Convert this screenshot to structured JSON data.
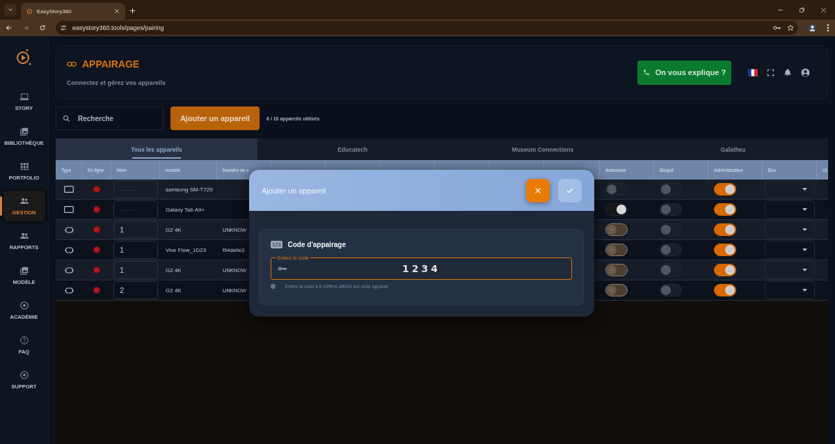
{
  "browser": {
    "tab_title": "EasyStory360",
    "url": "easystory360.tools/pages/pairing"
  },
  "sidebar": {
    "items": [
      {
        "label": "STORY",
        "selected": false
      },
      {
        "label": "BIBLIOTHÈQUE",
        "selected": false
      },
      {
        "label": "PORTFOLIO",
        "selected": false
      },
      {
        "label": "GESTION",
        "selected": true
      },
      {
        "label": "RAPPORTS",
        "selected": false
      },
      {
        "label": "MODÈLE",
        "selected": false
      },
      {
        "label": "ACADÉMIE",
        "selected": false
      },
      {
        "label": "FAQ",
        "selected": false
      },
      {
        "label": "SUPPORT",
        "selected": false
      }
    ]
  },
  "header": {
    "title": "APPAIRAGE",
    "subtitle": "Connectez et gérez vos appareils",
    "help_button": "On vous explique ?"
  },
  "toolbar": {
    "search_placeholder": "Recherche",
    "add_button": "Ajouter un appareil",
    "usage": "6 / 10 appareils utilisés"
  },
  "tabs": [
    {
      "label": "Tous les appareils",
      "selected": true
    },
    {
      "label": "Educatech",
      "selected": false
    },
    {
      "label": "Museum Connections",
      "selected": false
    },
    {
      "label": "Galathea",
      "selected": false
    }
  ],
  "table": {
    "columns": [
      "Type",
      "En ligne",
      "Nom",
      "modèle",
      "Numéro de s",
      "Autonome",
      "Bloqué",
      "Administrateur",
      "Box",
      "Ut"
    ],
    "rows": [
      {
        "kind": "tablet",
        "online": false,
        "name": "------",
        "model": "samsung SM-T720",
        "autonome": false,
        "autonome_disabled": false,
        "blocked": false,
        "admin": true
      },
      {
        "kind": "tablet",
        "online": false,
        "name": "------",
        "model": "Galaxy Tab A9+",
        "autonome": true,
        "autonome_disabled": false,
        "blocked": false,
        "admin": true
      },
      {
        "kind": "headset",
        "online": false,
        "name": "1",
        "model": "G2 4K",
        "serial": "UNKNOW",
        "autonome": false,
        "autonome_disabled": true,
        "blocked": false,
        "admin": true
      },
      {
        "kind": "headset",
        "online": false,
        "name": "1",
        "model": "Vive Flow_1D23",
        "serial": "f94da9e3",
        "autonome": false,
        "autonome_disabled": true,
        "blocked": false,
        "admin": true
      },
      {
        "kind": "headset",
        "online": false,
        "name": "1",
        "model": "G2 4K",
        "serial": "UNKNOW",
        "autonome": false,
        "autonome_disabled": true,
        "blocked": false,
        "admin": true
      },
      {
        "kind": "headset",
        "online": false,
        "name": "2",
        "model": "G2 4K",
        "serial": "UNKNOW",
        "autonome": false,
        "autonome_disabled": true,
        "blocked": false,
        "admin": true
      }
    ]
  },
  "dialog": {
    "title": "Ajouter un appareil",
    "section_badge": "123",
    "section_title": "Code d'appairage",
    "field_label": "Entrez le code",
    "field_value": "1234",
    "hint": "Entrez le code à 6 chiffres affiché sur votre appareil"
  }
}
